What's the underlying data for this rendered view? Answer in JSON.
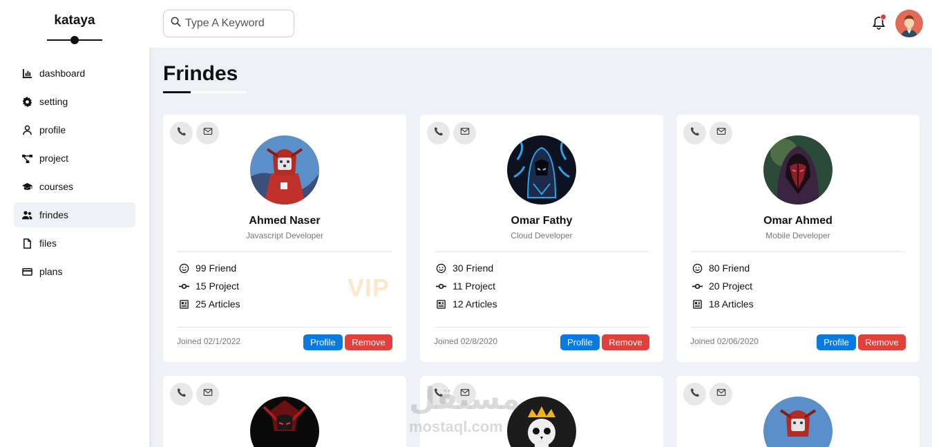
{
  "sidebar": {
    "brand": "kataya",
    "items": [
      {
        "label": "dashboard",
        "icon": "chart-bar-icon"
      },
      {
        "label": "setting",
        "icon": "gear-icon"
      },
      {
        "label": "profile",
        "icon": "user-icon"
      },
      {
        "label": "project",
        "icon": "diagram-icon"
      },
      {
        "label": "courses",
        "icon": "graduation-cap-icon"
      },
      {
        "label": "frindes",
        "icon": "users-icon",
        "active": true
      },
      {
        "label": "files",
        "icon": "file-icon"
      },
      {
        "label": "plans",
        "icon": "credit-card-icon"
      }
    ]
  },
  "header": {
    "search_placeholder": "Type A Keyword",
    "notification_icon": "bell-icon",
    "notification_badge_color": "#e53935"
  },
  "page": {
    "title": "Frindes"
  },
  "cards": [
    {
      "name": "Ahmed Naser",
      "role": "Javascript Developer",
      "friends": "99 Friend",
      "projects": "15 Project",
      "articles": "25 Articles",
      "badge": "VIP",
      "joined": "Joined 02/1/2022",
      "profile_label": "Profile",
      "remove_label": "Remove"
    },
    {
      "name": "Omar Fathy",
      "role": "Cloud Developer",
      "friends": "30 Friend",
      "projects": "11 Project",
      "articles": "12 Articles",
      "joined": "Joined 02/8/2020",
      "profile_label": "Profile",
      "remove_label": "Remove"
    },
    {
      "name": "Omar Ahmed",
      "role": "Mobile Developer",
      "friends": "80 Friend",
      "projects": "20 Project",
      "articles": "18 Articles",
      "joined": "Joined 02/06/2020",
      "profile_label": "Profile",
      "remove_label": "Remove"
    }
  ],
  "colors": {
    "accent_blue": "#0b7ae0",
    "danger_red": "#e0413a",
    "background": "#eef1f5",
    "vip": "#fbe8cc"
  },
  "watermark": {
    "arabic": "مستقل",
    "latin": "mostaql.com"
  }
}
